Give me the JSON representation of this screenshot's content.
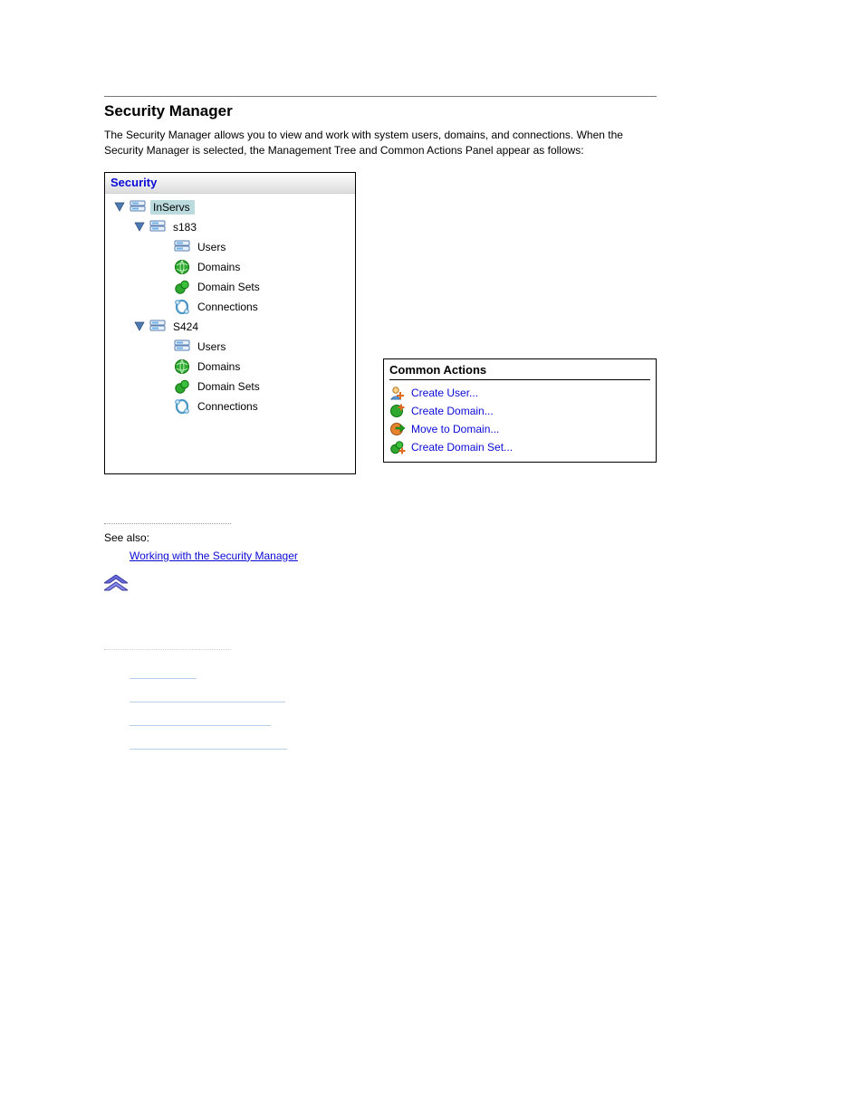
{
  "title": "Security Manager",
  "intro": "The Security Manager allows you to view and work with system users, domains, and connections. When the Security Manager is selected, the Management Tree and Common Actions Panel appear as follows:",
  "tree": {
    "header": "Security",
    "root": "InServs",
    "server1": {
      "name": "s183",
      "users": "Users",
      "domains": "Domains",
      "domain_sets": "Domain Sets",
      "connections": "Connections"
    },
    "server2": {
      "name": "S424",
      "users": "Users",
      "domains": "Domains",
      "domain_sets": "Domain Sets",
      "connections": "Connections"
    }
  },
  "common_actions": {
    "title": "Common Actions",
    "create_user": "Create User...",
    "create_domain": "Create Domain...",
    "move_to_domain": "Move to Domain...",
    "create_domain_set": "Create Domain Set..."
  },
  "see_also": {
    "label": "See also:",
    "link": "Working with the Security Manager"
  }
}
